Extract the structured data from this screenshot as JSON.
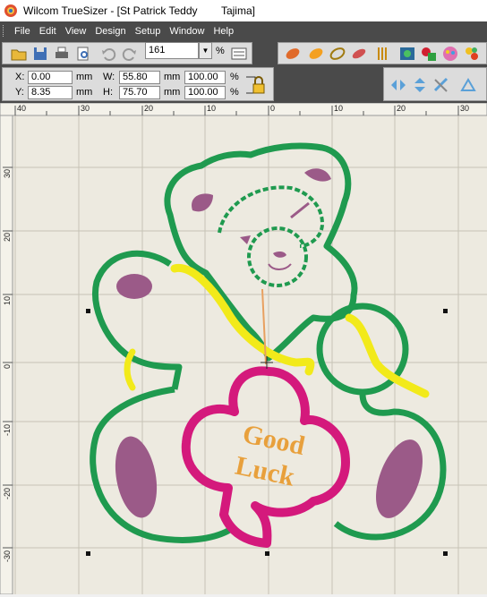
{
  "window": {
    "title": "Wilcom TrueSizer - [St Patrick Teddy        Tajima]"
  },
  "menu": {
    "items": [
      "File",
      "Edit",
      "View",
      "Design",
      "Setup",
      "Window",
      "Help"
    ]
  },
  "toolbar": {
    "zoom_value": "161",
    "zoom_unit": "%"
  },
  "properties": {
    "x_label": "X:",
    "x_value": "0.00",
    "y_label": "Y:",
    "y_value": "8.35",
    "w_label": "W:",
    "w_value": "55.80",
    "h_label": "H:",
    "h_value": "75.70",
    "unit": "mm",
    "w_pct": "100.00",
    "h_pct": "100.00",
    "pct_unit": "%"
  },
  "ruler": {
    "top_labels": [
      "40",
      "30",
      "20",
      "10",
      "0",
      "10",
      "20",
      "30"
    ],
    "left_labels": [
      "30",
      "20",
      "10",
      "0",
      "-10",
      "-20",
      "-30"
    ]
  },
  "design": {
    "badge_text_line1": "Good",
    "badge_text_line2": "Luck"
  },
  "colors": {
    "green": "#1f9a4f",
    "pink": "#d4197c",
    "yellow": "#f2ea1a",
    "mauve": "#9b5a88",
    "orange": "#e8a03c",
    "canvas": "#edeae0"
  }
}
